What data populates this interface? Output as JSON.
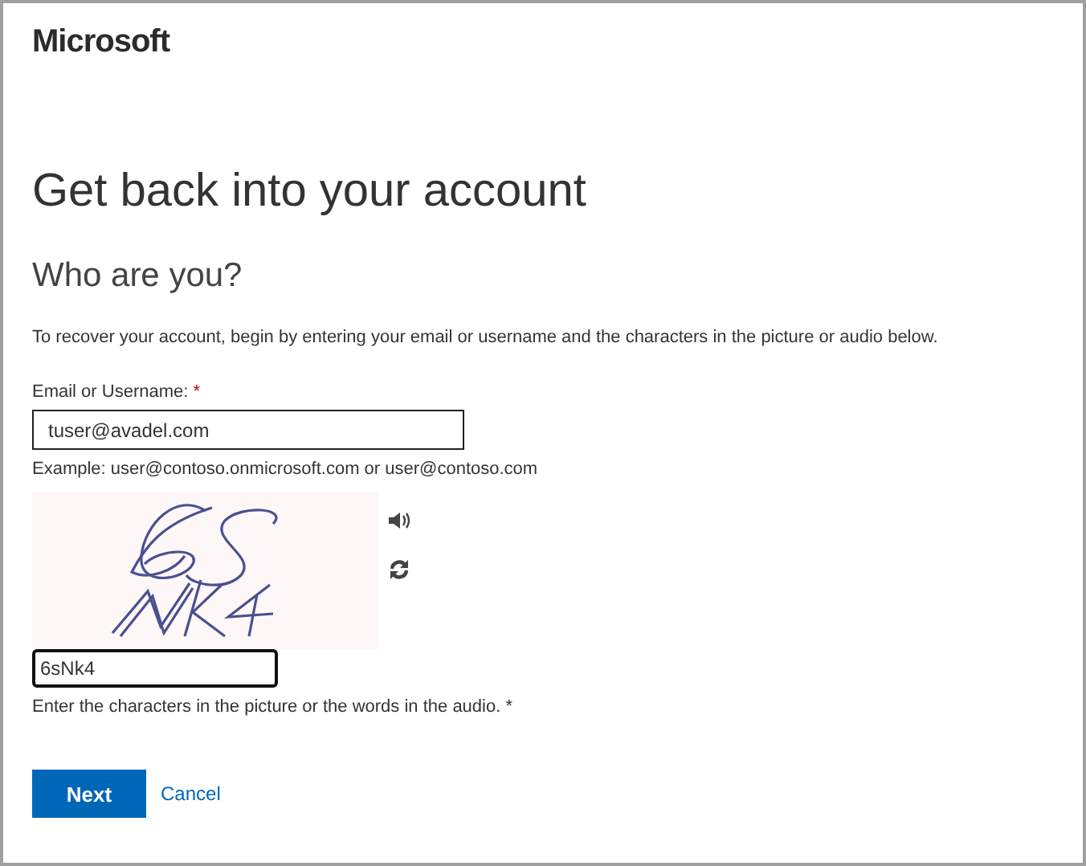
{
  "brand": {
    "name": "Microsoft"
  },
  "title": "Get back into your account",
  "subtitle": "Who are you?",
  "description": "To recover your account, begin by entering your email or username and the characters in the picture or audio below.",
  "email": {
    "label": "Email or Username:",
    "required_mark": "*",
    "value": "tuser@avadel.com",
    "hint": "Example: user@contoso.onmicrosoft.com or user@contoso.com"
  },
  "captcha": {
    "value": "6sNk4",
    "hint": "Enter the characters in the picture or the words in the audio. *"
  },
  "buttons": {
    "next": "Next",
    "cancel": "Cancel"
  }
}
